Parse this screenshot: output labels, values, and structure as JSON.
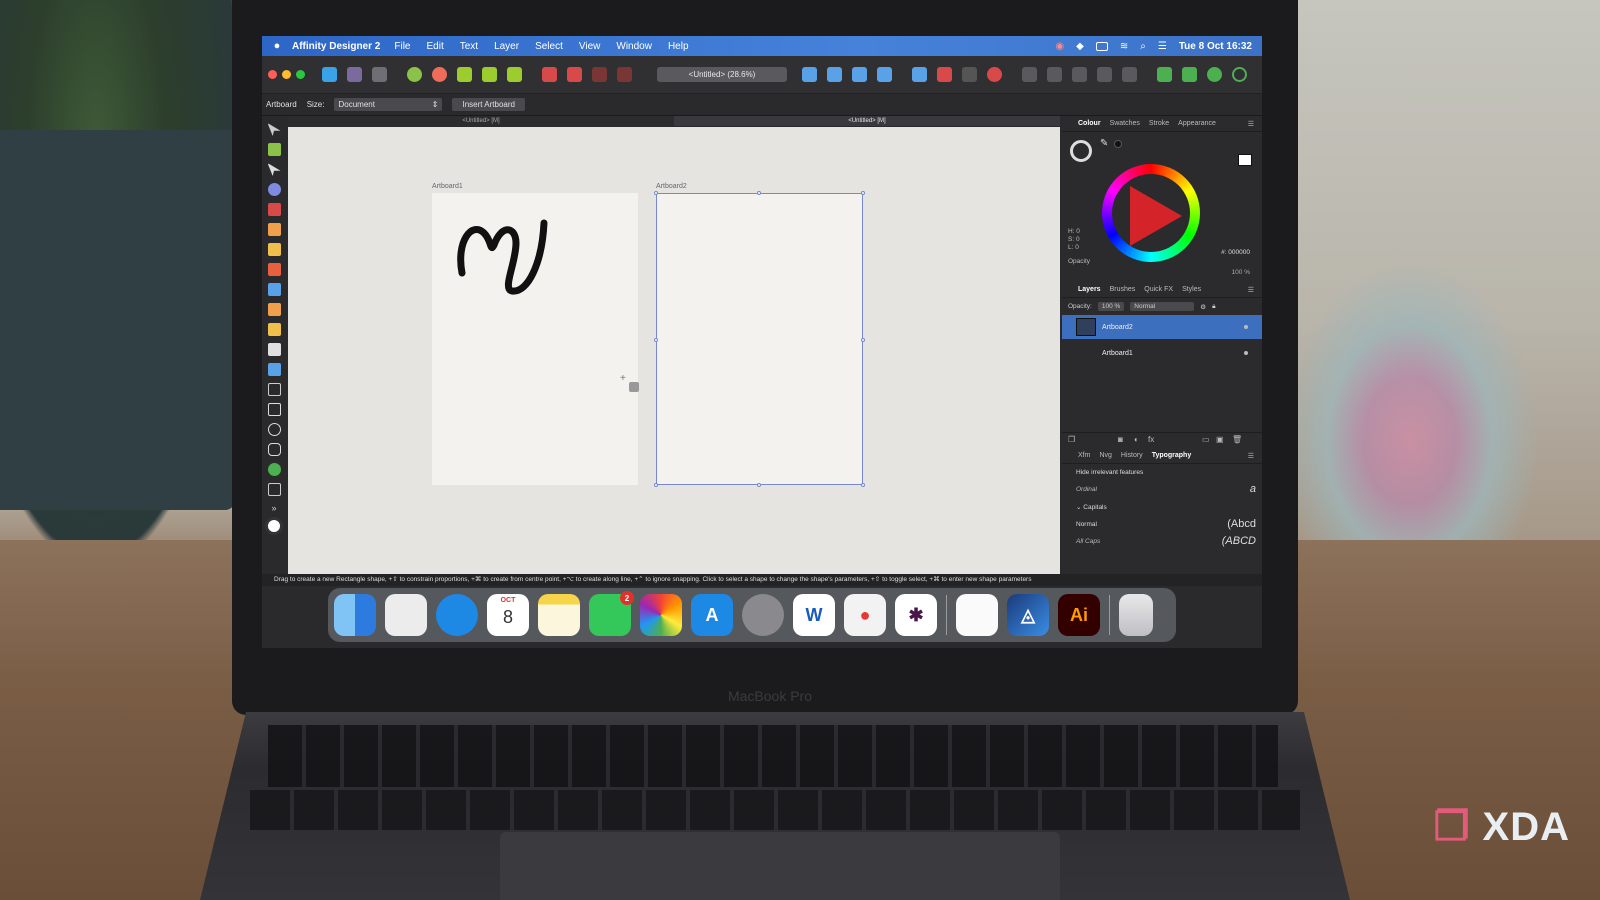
{
  "menubar": {
    "app_name": "Affinity Designer 2",
    "items": [
      "File",
      "Edit",
      "Text",
      "Layer",
      "Select",
      "View",
      "Window",
      "Help"
    ],
    "clock": "Tue 8 Oct  16:32"
  },
  "toolbar": {
    "doc_title": "<Untitled> (28.6%)"
  },
  "context_bar": {
    "tool_label": "Artboard",
    "size_label": "Size:",
    "size_value": "Document",
    "insert_button": "Insert Artboard"
  },
  "doc_tabs": [
    "<Untitled> [M]",
    "<Untitled> [M]"
  ],
  "canvas": {
    "artboard1_label": "Artboard1",
    "artboard2_label": "Artboard2"
  },
  "status_bar": "Drag to create a new Rectangle shape, +⇧ to constrain proportions, +⌘ to create from centre point, +⌥ to create along line, +⌃ to ignore snapping. Click to select a shape to change the shape's parameters, +⇧ to toggle select, +⌘ to enter new shape parameters",
  "colour_panel": {
    "tabs": [
      "Colour",
      "Swatches",
      "Stroke",
      "Appearance"
    ],
    "h": "H: 0",
    "s": "S: 0",
    "l": "L: 0",
    "hex": "#: 000000",
    "opacity_label": "Opacity",
    "opacity_value": "100 %"
  },
  "layers_panel": {
    "tabs": [
      "Layers",
      "Brushes",
      "Quick FX",
      "Styles"
    ],
    "opacity_label": "Opacity:",
    "opacity_value": "100 %",
    "blend_mode": "Normal",
    "layers": [
      "Artboard2",
      "Artboard1"
    ]
  },
  "typography_panel": {
    "tabs": [
      "Xfm",
      "Nvg",
      "History",
      "Typography"
    ],
    "hide_irrelevant": "Hide irrelevant features",
    "ordinal_label": "Ordinal",
    "ordinal_sample": "a",
    "capitals_header": "Capitals",
    "normal_label": "Normal",
    "normal_sample": "(Abcd",
    "allcaps_label": "All Caps",
    "allcaps_sample": "(ABCD"
  },
  "dock": {
    "calendar_month": "OCT",
    "calendar_day": "8",
    "messages_badge": "2",
    "word_letter": "W",
    "ai_label": "Ai"
  },
  "brand": {
    "laptop_label": "MacBook Pro",
    "watermark": "XDA"
  }
}
